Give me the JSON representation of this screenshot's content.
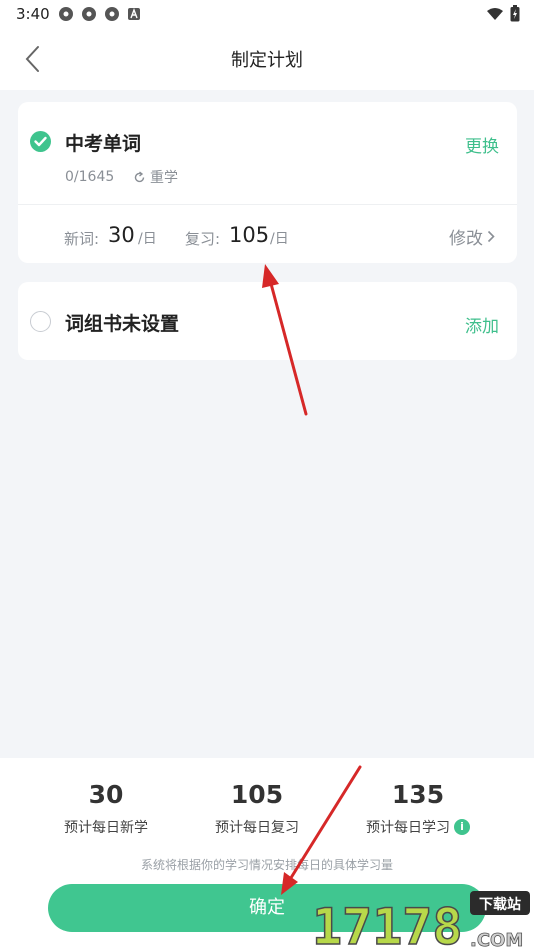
{
  "status_bar": {
    "time": "3:40"
  },
  "header": {
    "title": "制定计划"
  },
  "vocab_card": {
    "book_name": "中考单词",
    "action_label": "更换",
    "progress": "0/1645",
    "relearn_label": "重学",
    "new_words_label": "新词:",
    "new_words_value": "30",
    "review_label": "复习:",
    "review_value": "105",
    "per_day_unit": "/日",
    "modify_label": "修改"
  },
  "phrase_card": {
    "title": "词组书未设置",
    "action_label": "添加"
  },
  "summary": {
    "items": [
      {
        "value": "30",
        "label": "预计每日新学"
      },
      {
        "value": "105",
        "label": "预计每日复习"
      },
      {
        "value": "135",
        "label": "预计每日学习"
      }
    ],
    "note": "系统将根据你的学习情况安排每日的具体学习量",
    "confirm_label": "确定"
  },
  "watermark": {
    "site": "下载站",
    "digits": "17178",
    "domain": ".COM"
  },
  "colors": {
    "accent": "#3fc48e",
    "background": "#f3f5f8",
    "annotation_arrow": "#d62828"
  }
}
